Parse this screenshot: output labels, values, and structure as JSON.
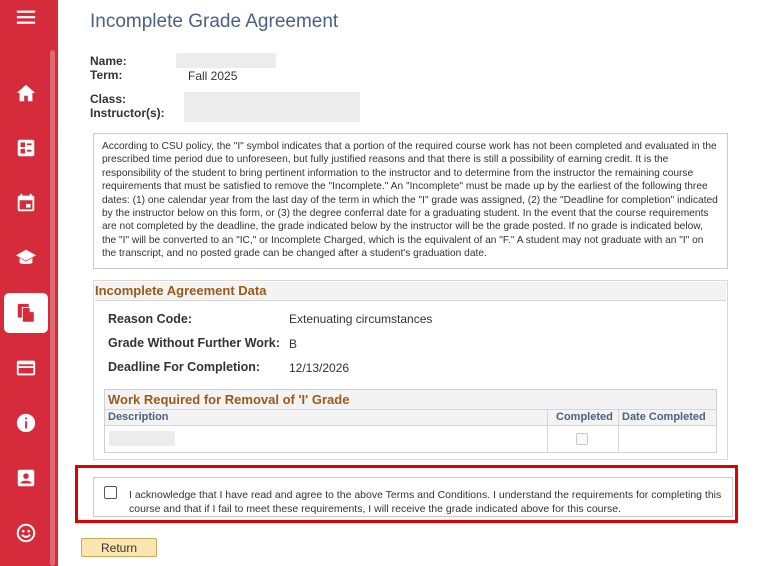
{
  "page": {
    "title": "Incomplete Grade Agreement"
  },
  "student": {
    "name_label": "Name:",
    "term_label": "Term:",
    "term_value": "Fall 2025",
    "class_label": "Class:",
    "instructor_label": "Instructor(s):"
  },
  "policy_text": "According to CSU policy, the \"I\" symbol indicates that a portion of the required course work has not been completed and evaluated in the prescribed time period due to unforeseen, but fully justified reasons and that there is still a possibility of earning credit.  It is the responsibility of the student to bring pertinent information to the instructor and to determine from the instructor the remaining course requirements that must be satisfied to remove the \"Incomplete.\"  An \"Incomplete\" must be made up by the earliest of the following three dates: (1) one calendar year from the last day of the term in which the \"I\" grade was assigned, (2) the \"Deadline for completion\" indicated by the instructor below on this form, or (3) the degree conferral date for a graduating student.  In the event that the course requirements are not completed by the deadline, the grade indicated below by the instructor will be the grade posted.  If no grade is indicated below, the \"I\" will be converted to an \"IC,\" or Incomplete Charged, which is the equivalent of an \"F.\"  A student may not graduate with an \"I\" on the transcript, and no posted grade can be changed after a student's graduation date.",
  "agreement": {
    "header": "Incomplete Agreement Data",
    "reason_label": "Reason Code:",
    "reason_value": "Extenuating circumstances",
    "grade_label": "Grade Without Further Work:",
    "grade_value": "B",
    "deadline_label": "Deadline For Completion:",
    "deadline_value": "12/13/2026"
  },
  "work": {
    "header": "Work Required for Removal of 'I' Grade",
    "columns": [
      "Description",
      "Completed",
      "Date Completed"
    ]
  },
  "acknowledgement": {
    "text": "I acknowledge that I have read and agree to the above Terms and Conditions.  I understand the requirements for completing this course and that if I fail to meet these requirements, I will receive the grade indicated above for this course.",
    "checked": false
  },
  "buttons": {
    "return_label": "Return"
  },
  "sidebar": {
    "items": [
      {
        "icon": "menu-icon"
      },
      {
        "icon": "home-icon"
      },
      {
        "icon": "dashboard-icon"
      },
      {
        "icon": "calendar-icon"
      },
      {
        "icon": "graduation-cap-icon"
      },
      {
        "icon": "documents-icon",
        "active": true
      },
      {
        "icon": "credit-card-icon"
      },
      {
        "icon": "info-icon"
      },
      {
        "icon": "contact-card-icon"
      },
      {
        "icon": "smiley-icon"
      }
    ]
  },
  "colors": {
    "sidebar": "#d52b3a",
    "title": "#4a6182",
    "section_header": "#9b5a1a",
    "highlight": "#e00000",
    "button": "#fbe6b0"
  }
}
